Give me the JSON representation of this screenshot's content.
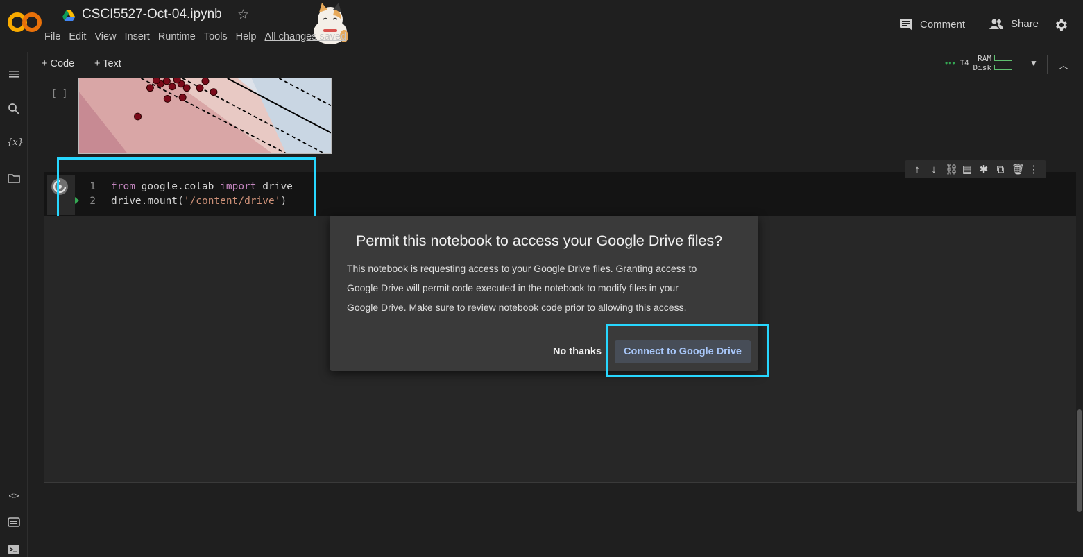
{
  "header": {
    "title": "CSCI5527-Oct-04.ipynb",
    "menu": [
      "File",
      "Edit",
      "View",
      "Insert",
      "Runtime",
      "Tools",
      "Help"
    ],
    "save_status": "All changes saved",
    "comment_label": "Comment",
    "share_label": "Share"
  },
  "toolbar": {
    "add_code": "+ Code",
    "add_text": "+ Text",
    "runtime_type": "T4",
    "ram_label": "RAM",
    "disk_label": "Disk"
  },
  "output_cell": {
    "bracket": "[ ]"
  },
  "code_cell": {
    "line_numbers": [
      "1",
      "2"
    ],
    "line1": {
      "kw1": "from",
      "mod": " google.colab ",
      "kw2": "import",
      "name": " drive"
    },
    "line2": {
      "call": "drive.mount(",
      "quote_open": "'",
      "path": "/content/drive",
      "quote_close": "'",
      "end": ")"
    }
  },
  "dialog": {
    "title": "Permit this notebook to access your Google Drive files?",
    "body_lines": [
      "This notebook is requesting access to your Google Drive files. Granting access to",
      "Google Drive will permit code executed in the notebook to modify files in your",
      "Google Drive. Make sure to review notebook code prior to allowing this access."
    ],
    "cancel_label": "No thanks",
    "confirm_label": "Connect to Google Drive"
  },
  "colors": {
    "highlight": "#27d7ff",
    "confirm_text": "#a8c7fa",
    "runtime_dots": "#34a853"
  }
}
